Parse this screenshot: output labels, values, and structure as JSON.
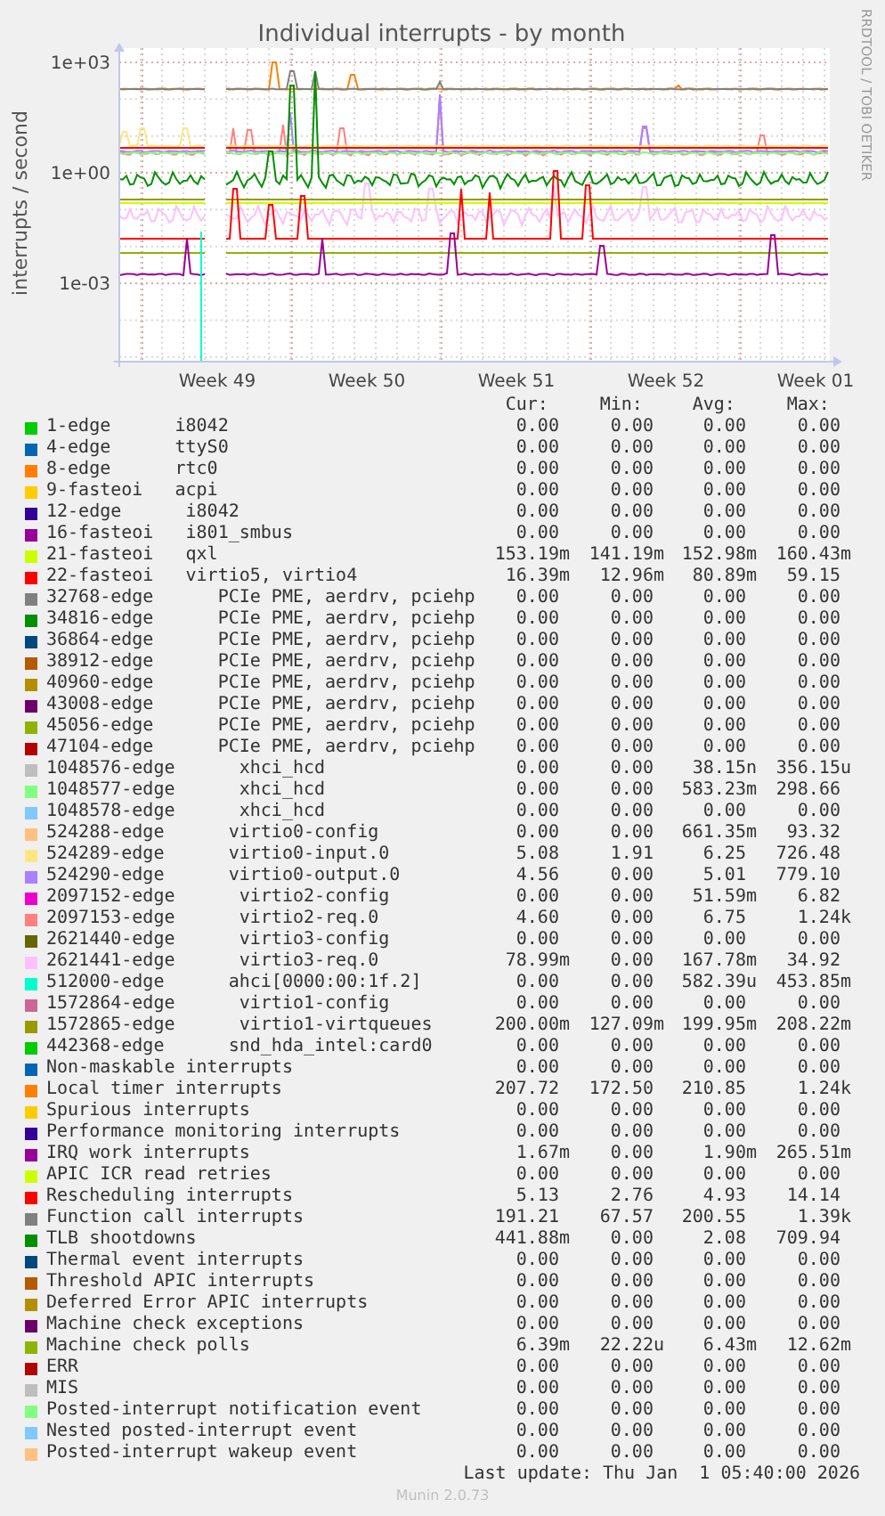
{
  "chart": {
    "title": "Individual interrupts - by month",
    "ylabel": "interrupts / second",
    "y_tick_labels": [
      "1e+03",
      "1e+00",
      "1e-03"
    ],
    "x_tick_labels": [
      "Week 49",
      "Week 50",
      "Week 51",
      "Week 52",
      "Week 01"
    ],
    "credit": "RRDTOOL / TOBI OETIKER"
  },
  "legend": {
    "columns": [
      "Cur:",
      "Min:",
      "Avg:",
      "Max:"
    ],
    "rows": [
      {
        "label": "1-edge      i8042",
        "color": "#00cc00",
        "cur": "0.00",
        "min": "0.00",
        "avg": "0.00",
        "max": "0.00"
      },
      {
        "label": "4-edge      ttyS0",
        "color": "#0066b3",
        "cur": "0.00",
        "min": "0.00",
        "avg": "0.00",
        "max": "0.00"
      },
      {
        "label": "8-edge      rtc0",
        "color": "#ff8000",
        "cur": "0.00",
        "min": "0.00",
        "avg": "0.00",
        "max": "0.00"
      },
      {
        "label": "9-fasteoi   acpi",
        "color": "#ffcc00",
        "cur": "0.00",
        "min": "0.00",
        "avg": "0.00",
        "max": "0.00"
      },
      {
        "label": "12-edge      i8042",
        "color": "#330099",
        "cur": "0.00",
        "min": "0.00",
        "avg": "0.00",
        "max": "0.00"
      },
      {
        "label": "16-fasteoi   i801_smbus",
        "color": "#990099",
        "cur": "0.00",
        "min": "0.00",
        "avg": "0.00",
        "max": "0.00"
      },
      {
        "label": "21-fasteoi   qxl",
        "color": "#ccff00",
        "cur": "153.19m",
        "min": "141.19m",
        "avg": "152.98m",
        "max": "160.43m"
      },
      {
        "label": "22-fasteoi   virtio5, virtio4",
        "color": "#ff0000",
        "cur": "16.39m",
        "min": "12.96m",
        "avg": "80.89m",
        "max": "59.15"
      },
      {
        "label": "32768-edge      PCIe PME, aerdrv, pciehp",
        "color": "#808080",
        "cur": "0.00",
        "min": "0.00",
        "avg": "0.00",
        "max": "0.00"
      },
      {
        "label": "34816-edge      PCIe PME, aerdrv, pciehp",
        "color": "#008f00",
        "cur": "0.00",
        "min": "0.00",
        "avg": "0.00",
        "max": "0.00"
      },
      {
        "label": "36864-edge      PCIe PME, aerdrv, pciehp",
        "color": "#00487d",
        "cur": "0.00",
        "min": "0.00",
        "avg": "0.00",
        "max": "0.00"
      },
      {
        "label": "38912-edge      PCIe PME, aerdrv, pciehp",
        "color": "#b35a00",
        "cur": "0.00",
        "min": "0.00",
        "avg": "0.00",
        "max": "0.00"
      },
      {
        "label": "40960-edge      PCIe PME, aerdrv, pciehp",
        "color": "#b38f00",
        "cur": "0.00",
        "min": "0.00",
        "avg": "0.00",
        "max": "0.00"
      },
      {
        "label": "43008-edge      PCIe PME, aerdrv, pciehp",
        "color": "#6b006b",
        "cur": "0.00",
        "min": "0.00",
        "avg": "0.00",
        "max": "0.00"
      },
      {
        "label": "45056-edge      PCIe PME, aerdrv, pciehp",
        "color": "#8fb300",
        "cur": "0.00",
        "min": "0.00",
        "avg": "0.00",
        "max": "0.00"
      },
      {
        "label": "47104-edge      PCIe PME, aerdrv, pciehp",
        "color": "#b30000",
        "cur": "0.00",
        "min": "0.00",
        "avg": "0.00",
        "max": "0.00"
      },
      {
        "label": "1048576-edge      xhci_hcd",
        "color": "#bebebe",
        "cur": "0.00",
        "min": "0.00",
        "avg": "38.15n",
        "max": "356.15u"
      },
      {
        "label": "1048577-edge      xhci_hcd",
        "color": "#80ff80",
        "cur": "0.00",
        "min": "0.00",
        "avg": "583.23m",
        "max": "298.66"
      },
      {
        "label": "1048578-edge      xhci_hcd",
        "color": "#80c9ff",
        "cur": "0.00",
        "min": "0.00",
        "avg": "0.00",
        "max": "0.00"
      },
      {
        "label": "524288-edge      virtio0-config",
        "color": "#ffc080",
        "cur": "0.00",
        "min": "0.00",
        "avg": "661.35m",
        "max": "93.32"
      },
      {
        "label": "524289-edge      virtio0-input.0",
        "color": "#ffe680",
        "cur": "5.08",
        "min": "1.91",
        "avg": "6.25",
        "max": "726.48"
      },
      {
        "label": "524290-edge      virtio0-output.0",
        "color": "#aa80ff",
        "cur": "4.56",
        "min": "0.00",
        "avg": "5.01",
        "max": "779.10"
      },
      {
        "label": "2097152-edge      virtio2-config",
        "color": "#ee00cc",
        "cur": "0.00",
        "min": "0.00",
        "avg": "51.59m",
        "max": "6.82"
      },
      {
        "label": "2097153-edge      virtio2-req.0",
        "color": "#ff8080",
        "cur": "4.60",
        "min": "0.00",
        "avg": "6.75",
        "max": "1.24k"
      },
      {
        "label": "2621440-edge      virtio3-config",
        "color": "#666600",
        "cur": "0.00",
        "min": "0.00",
        "avg": "0.00",
        "max": "0.00"
      },
      {
        "label": "2621441-edge      virtio3-req.0",
        "color": "#ffbfff",
        "cur": "78.99m",
        "min": "0.00",
        "avg": "167.78m",
        "max": "34.92"
      },
      {
        "label": "512000-edge      ahci[0000:00:1f.2]",
        "color": "#00ffcc",
        "cur": "0.00",
        "min": "0.00",
        "avg": "582.39u",
        "max": "453.85m"
      },
      {
        "label": "1572864-edge      virtio1-config",
        "color": "#cc6699",
        "cur": "0.00",
        "min": "0.00",
        "avg": "0.00",
        "max": "0.00"
      },
      {
        "label": "1572865-edge      virtio1-virtqueues",
        "color": "#999900",
        "cur": "200.00m",
        "min": "127.09m",
        "avg": "199.95m",
        "max": "208.22m"
      },
      {
        "label": "442368-edge      snd_hda_intel:card0",
        "color": "#00cc00",
        "cur": "0.00",
        "min": "0.00",
        "avg": "0.00",
        "max": "0.00"
      },
      {
        "label": "Non-maskable interrupts",
        "color": "#0066b3",
        "cur": "0.00",
        "min": "0.00",
        "avg": "0.00",
        "max": "0.00"
      },
      {
        "label": "Local timer interrupts",
        "color": "#ff8000",
        "cur": "207.72",
        "min": "172.50",
        "avg": "210.85",
        "max": "1.24k"
      },
      {
        "label": "Spurious interrupts",
        "color": "#ffcc00",
        "cur": "0.00",
        "min": "0.00",
        "avg": "0.00",
        "max": "0.00"
      },
      {
        "label": "Performance monitoring interrupts",
        "color": "#330099",
        "cur": "0.00",
        "min": "0.00",
        "avg": "0.00",
        "max": "0.00"
      },
      {
        "label": "IRQ work interrupts",
        "color": "#990099",
        "cur": "1.67m",
        "min": "0.00",
        "avg": "1.90m",
        "max": "265.51m"
      },
      {
        "label": "APIC ICR read retries",
        "color": "#ccff00",
        "cur": "0.00",
        "min": "0.00",
        "avg": "0.00",
        "max": "0.00"
      },
      {
        "label": "Rescheduling interrupts",
        "color": "#ff0000",
        "cur": "5.13",
        "min": "2.76",
        "avg": "4.93",
        "max": "14.14"
      },
      {
        "label": "Function call interrupts",
        "color": "#808080",
        "cur": "191.21",
        "min": "67.57",
        "avg": "200.55",
        "max": "1.39k"
      },
      {
        "label": "TLB shootdowns",
        "color": "#008f00",
        "cur": "441.88m",
        "min": "0.00",
        "avg": "2.08",
        "max": "709.94"
      },
      {
        "label": "Thermal event interrupts",
        "color": "#00487d",
        "cur": "0.00",
        "min": "0.00",
        "avg": "0.00",
        "max": "0.00"
      },
      {
        "label": "Threshold APIC interrupts",
        "color": "#b35a00",
        "cur": "0.00",
        "min": "0.00",
        "avg": "0.00",
        "max": "0.00"
      },
      {
        "label": "Deferred Error APIC interrupts",
        "color": "#b38f00",
        "cur": "0.00",
        "min": "0.00",
        "avg": "0.00",
        "max": "0.00"
      },
      {
        "label": "Machine check exceptions",
        "color": "#6b006b",
        "cur": "0.00",
        "min": "0.00",
        "avg": "0.00",
        "max": "0.00"
      },
      {
        "label": "Machine check polls",
        "color": "#8fb300",
        "cur": "6.39m",
        "min": "22.22u",
        "avg": "6.43m",
        "max": "12.62m"
      },
      {
        "label": "ERR",
        "color": "#b30000",
        "cur": "0.00",
        "min": "0.00",
        "avg": "0.00",
        "max": "0.00"
      },
      {
        "label": "MIS",
        "color": "#bebebe",
        "cur": "0.00",
        "min": "0.00",
        "avg": "0.00",
        "max": "0.00"
      },
      {
        "label": "Posted-interrupt notification event",
        "color": "#80ff80",
        "cur": "0.00",
        "min": "0.00",
        "avg": "0.00",
        "max": "0.00"
      },
      {
        "label": "Nested posted-interrupt event",
        "color": "#80c9ff",
        "cur": "0.00",
        "min": "0.00",
        "avg": "0.00",
        "max": "0.00"
      },
      {
        "label": "Posted-interrupt wakeup event",
        "color": "#ffc080",
        "cur": "0.00",
        "min": "0.00",
        "avg": "0.00",
        "max": "0.00"
      }
    ]
  },
  "last_update": "Last update: Thu Jan  1 05:40:00 2026",
  "footer": "Munin 2.0.73"
}
